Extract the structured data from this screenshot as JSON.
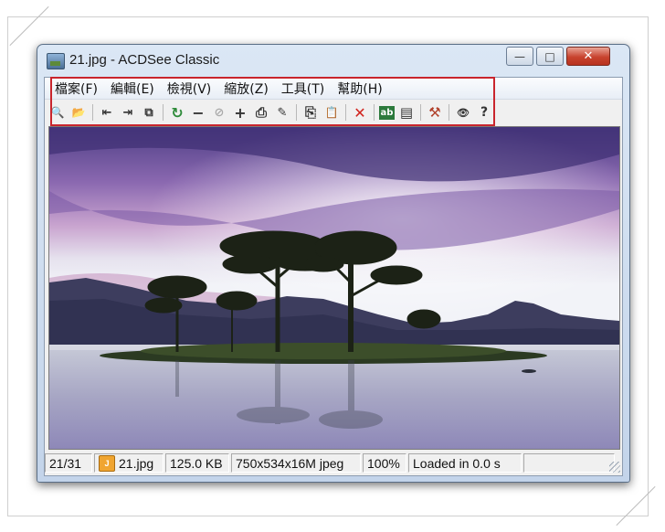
{
  "window": {
    "title": "21.jpg - ACDSee Classic",
    "minimize_glyph": "—",
    "maximize_glyph": "□",
    "close_glyph": "✕"
  },
  "menu": {
    "items": [
      {
        "label": "檔案(F)"
      },
      {
        "label": "編輯(E)"
      },
      {
        "label": "檢視(V)"
      },
      {
        "label": "縮放(Z)"
      },
      {
        "label": "工具(T)"
      },
      {
        "label": "幫助(H)"
      }
    ]
  },
  "toolbar": {
    "buttons": [
      {
        "icon": "browse-icon",
        "glyph": "🔍"
      },
      {
        "icon": "open-folder-icon",
        "glyph": "📂"
      },
      {
        "icon": "previous-image-icon",
        "glyph": "⇤"
      },
      {
        "icon": "next-image-icon",
        "glyph": "⇥"
      },
      {
        "icon": "fullscreen-icon",
        "glyph": "⧉"
      },
      {
        "icon": "rotate-icon",
        "glyph": "↻"
      },
      {
        "icon": "zoom-out-icon",
        "glyph": "−"
      },
      {
        "icon": "zoom-disabled-icon",
        "glyph": "⊘"
      },
      {
        "icon": "zoom-in-icon",
        "glyph": "+"
      },
      {
        "icon": "print-icon",
        "glyph": "⎙"
      },
      {
        "icon": "save-as-icon",
        "glyph": "✎"
      },
      {
        "icon": "copy-icon",
        "glyph": "⎘"
      },
      {
        "icon": "paste-icon",
        "glyph": "📋"
      },
      {
        "icon": "delete-icon",
        "glyph": "✕"
      },
      {
        "icon": "rename-icon",
        "glyph": "ab"
      },
      {
        "icon": "properties-icon",
        "glyph": "▤"
      },
      {
        "icon": "tools-icon",
        "glyph": "⚒"
      },
      {
        "icon": "eye-icon",
        "glyph": "👁"
      },
      {
        "icon": "help-icon",
        "glyph": "?"
      }
    ],
    "accent_colors": {
      "rotate": "#2e8b3a",
      "delete": "#d1231d",
      "highlight": "#c9252d"
    }
  },
  "statusbar": {
    "index": "21/31",
    "filename": "21.jpg",
    "filesize": "125.0 KB",
    "dimensions": "750x534x16M jpeg",
    "zoom": "100%",
    "load_time": "Loaded in 0.0 s"
  }
}
